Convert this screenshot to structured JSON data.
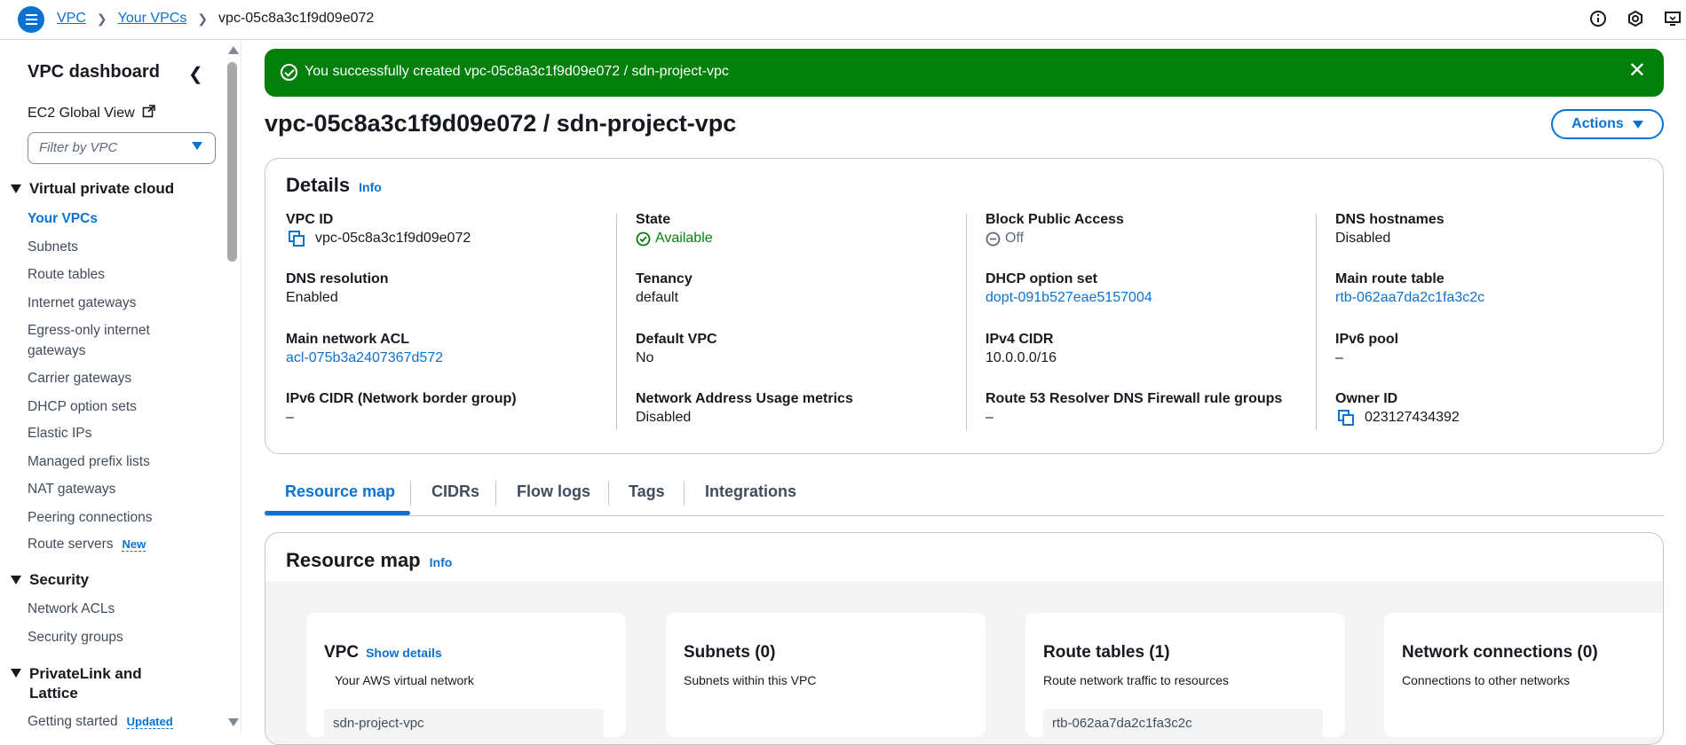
{
  "breadcrumb": {
    "root": "VPC",
    "parent": "Your VPCs",
    "current": "vpc-05c8a3c1f9d09e072"
  },
  "sidebar": {
    "title": "VPC dashboard",
    "ec2_global_view": "EC2 Global View",
    "filter_placeholder": "Filter by VPC",
    "sections": [
      {
        "title": "Virtual private cloud",
        "items": [
          {
            "label": "Your VPCs",
            "active": true
          },
          {
            "label": "Subnets"
          },
          {
            "label": "Route tables"
          },
          {
            "label": "Internet gateways"
          },
          {
            "label": "Egress-only internet gateways"
          },
          {
            "label": "Carrier gateways"
          },
          {
            "label": "DHCP option sets"
          },
          {
            "label": "Elastic IPs"
          },
          {
            "label": "Managed prefix lists"
          },
          {
            "label": "NAT gateways"
          },
          {
            "label": "Peering connections"
          },
          {
            "label": "Route servers",
            "badge": "New"
          }
        ]
      },
      {
        "title": "Security",
        "items": [
          {
            "label": "Network ACLs"
          },
          {
            "label": "Security groups"
          }
        ]
      },
      {
        "title": "PrivateLink and Lattice",
        "items": [
          {
            "label": "Getting started",
            "badge": "Updated"
          }
        ]
      }
    ]
  },
  "flash": {
    "message": "You successfully created vpc-05c8a3c1f9d09e072 / sdn-project-vpc"
  },
  "page": {
    "title": "vpc-05c8a3c1f9d09e072 / sdn-project-vpc",
    "actions_label": "Actions"
  },
  "details": {
    "title": "Details",
    "info": "Info",
    "col1": [
      {
        "key": "VPC ID",
        "value": "vpc-05c8a3c1f9d09e072"
      },
      {
        "key": "DNS resolution",
        "value": "Enabled"
      },
      {
        "key": "Main network ACL",
        "value": "acl-075b3a2407367d572"
      },
      {
        "key": "IPv6 CIDR (Network border group)",
        "value": "–"
      }
    ],
    "col2": [
      {
        "key": "State",
        "value": "Available"
      },
      {
        "key": "Tenancy",
        "value": "default"
      },
      {
        "key": "Default VPC",
        "value": "No"
      },
      {
        "key": "Network Address Usage metrics",
        "value": "Disabled"
      }
    ],
    "col3": [
      {
        "key": "Block Public Access",
        "value": "Off"
      },
      {
        "key": "DHCP option set",
        "value": "dopt-091b527eae5157004"
      },
      {
        "key": "IPv4 CIDR",
        "value": "10.0.0.0/16"
      },
      {
        "key": "Route 53 Resolver DNS Firewall rule groups",
        "value": "–"
      }
    ],
    "col4": [
      {
        "key": "DNS hostnames",
        "value": "Disabled"
      },
      {
        "key": "Main route table",
        "value": "rtb-062aa7da2c1fa3c2c"
      },
      {
        "key": "IPv6 pool",
        "value": "–"
      },
      {
        "key": "Owner ID",
        "value": "023127434392"
      }
    ]
  },
  "tabs": [
    "Resource map",
    "CIDRs",
    "Flow logs",
    "Tags",
    "Integrations"
  ],
  "resource_map": {
    "title": "Resource map",
    "info": "Info",
    "cards": [
      {
        "title": "VPC",
        "link": "Show details",
        "subtitle": "Your AWS virtual network",
        "item": "sdn-project-vpc"
      },
      {
        "title": "Subnets (0)",
        "subtitle": "Subnets within this VPC"
      },
      {
        "title": "Route tables (1)",
        "subtitle": "Route network traffic to resources",
        "item": "rtb-062aa7da2c1fa3c2c"
      },
      {
        "title": "Network connections (0)",
        "subtitle": "Connections to other networks"
      }
    ]
  },
  "colors": {
    "accent": "#0972d3",
    "success": "#037f0c"
  }
}
